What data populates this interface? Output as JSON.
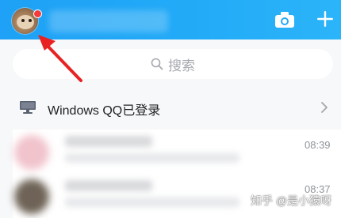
{
  "header": {
    "avatar_icon": "user-avatar-icon",
    "notification_dot_color": "#f23c3c",
    "camera_icon": "camera-icon",
    "add_icon": "plus-icon",
    "background_color": "#22aaf7"
  },
  "search": {
    "placeholder": "搜索",
    "icon": "search-icon"
  },
  "device_status": {
    "icon": "monitor-icon",
    "label": "Windows QQ已登录",
    "chevron_icon": "chevron-right-icon"
  },
  "chat_list": [
    {
      "time": "08:39",
      "avatar_color": "#f1c3cc"
    },
    {
      "time": "08:37",
      "avatar_color": "#6e6356"
    }
  ],
  "annotation": {
    "arrow_color": "#e82222"
  },
  "watermark": {
    "text": "知乎 @是小猿呀"
  }
}
